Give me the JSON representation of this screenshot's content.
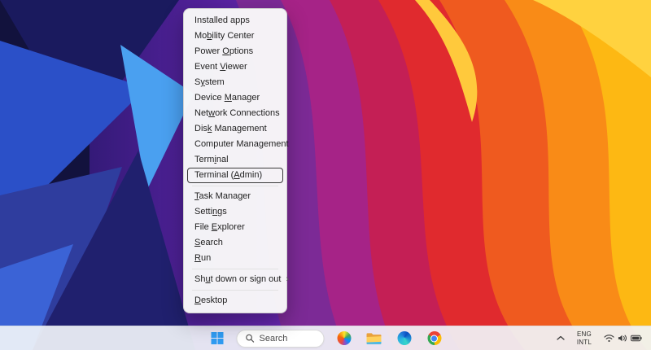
{
  "wallpaper": {
    "description": "abstract flowing ridges, blue shards left, violet center, red-orange-yellow folds right"
  },
  "menu": {
    "highlighted": "Terminal (Admin)",
    "groups": [
      {
        "items": [
          {
            "label": "Installed apps"
          },
          {
            "label": "Mobility Center",
            "u": 2
          },
          {
            "label": "Power Options",
            "u": 6
          },
          {
            "label": "Event Viewer",
            "u": 6
          },
          {
            "label": "System",
            "u": 1
          },
          {
            "label": "Device Manager",
            "u": 7
          },
          {
            "label": "Network Connections",
            "u": 3
          },
          {
            "label": "Disk Management",
            "u": 3
          },
          {
            "label": "Computer Management",
            "u": 13
          },
          {
            "label": "Terminal",
            "u": 4
          },
          {
            "label": "Terminal (Admin)",
            "u": 10
          }
        ]
      },
      {
        "items": [
          {
            "label": "Task Manager",
            "u": 0
          },
          {
            "label": "Settings",
            "u": 5
          },
          {
            "label": "File Explorer",
            "u": 5
          },
          {
            "label": "Search",
            "u": 0
          },
          {
            "label": "Run",
            "u": 0
          }
        ]
      },
      {
        "items": [
          {
            "label": "Shut down or sign out",
            "u": 2,
            "submenu": true
          }
        ]
      },
      {
        "items": [
          {
            "label": "Desktop",
            "u": 0
          }
        ]
      }
    ]
  },
  "taskbar": {
    "search_label": "Search",
    "icons": [
      "start",
      "search",
      "colorful-app",
      "file-explorer",
      "edge",
      "chrome"
    ],
    "tray": {
      "language_line1": "ENG",
      "language_line2": "INTL",
      "icons": [
        "chevron-up",
        "language",
        "wifi",
        "volume",
        "battery"
      ]
    }
  },
  "colors": {
    "menu_bg": "#f9f9f9",
    "highlight_border": "#3a3a3a",
    "taskbar_bg": "#f1f4f9",
    "start_blue": "#2f9bf1"
  }
}
